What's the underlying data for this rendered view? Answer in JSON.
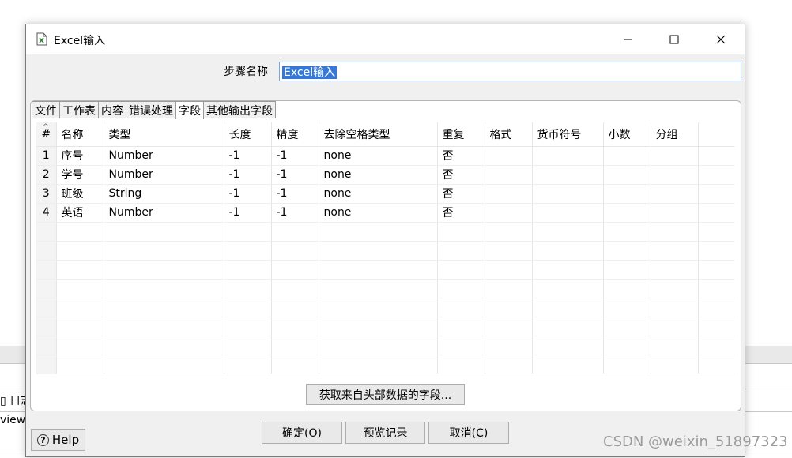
{
  "background": {
    "log_tab_label": "日志",
    "view_label": "view."
  },
  "dialog": {
    "title": "Excel输入",
    "step_name_label": "步骤名称",
    "step_name_value": "Excel输入",
    "tabs": [
      {
        "label": "文件",
        "active": false
      },
      {
        "label": "工作表",
        "active": false
      },
      {
        "label": "内容",
        "active": false
      },
      {
        "label": "错误处理",
        "active": false
      },
      {
        "label": "字段",
        "active": true
      },
      {
        "label": "其他输出字段",
        "active": false
      }
    ],
    "fields_table": {
      "sort_marker": "^",
      "headers": [
        "#",
        "名称",
        "类型",
        "长度",
        "精度",
        "去除空格类型",
        "重复",
        "格式",
        "货币符号",
        "小数",
        "分组"
      ],
      "rows": [
        [
          "1",
          "序号",
          "Number",
          "-1",
          "-1",
          "none",
          "否",
          "",
          "",
          "",
          ""
        ],
        [
          "2",
          "学号",
          "Number",
          "-1",
          "-1",
          "none",
          "否",
          "",
          "",
          "",
          ""
        ],
        [
          "3",
          "班级",
          "String",
          "-1",
          "-1",
          "none",
          "否",
          "",
          "",
          "",
          ""
        ],
        [
          "4",
          "英语",
          "Number",
          "-1",
          "-1",
          "none",
          "否",
          "",
          "",
          "",
          ""
        ]
      ],
      "empty_rows": 8
    },
    "get_fields_button": "获取来自头部数据的字段...",
    "help_button": "Help",
    "ok_button": "确定(O)",
    "preview_button": "预览记录",
    "cancel_button": "取消(C)"
  },
  "watermark": "CSDN @weixin_51897323",
  "colors": {
    "selection": "#3578d6",
    "dialog_bg": "#f0f0f0",
    "button_bg": "#e9e9e9"
  }
}
